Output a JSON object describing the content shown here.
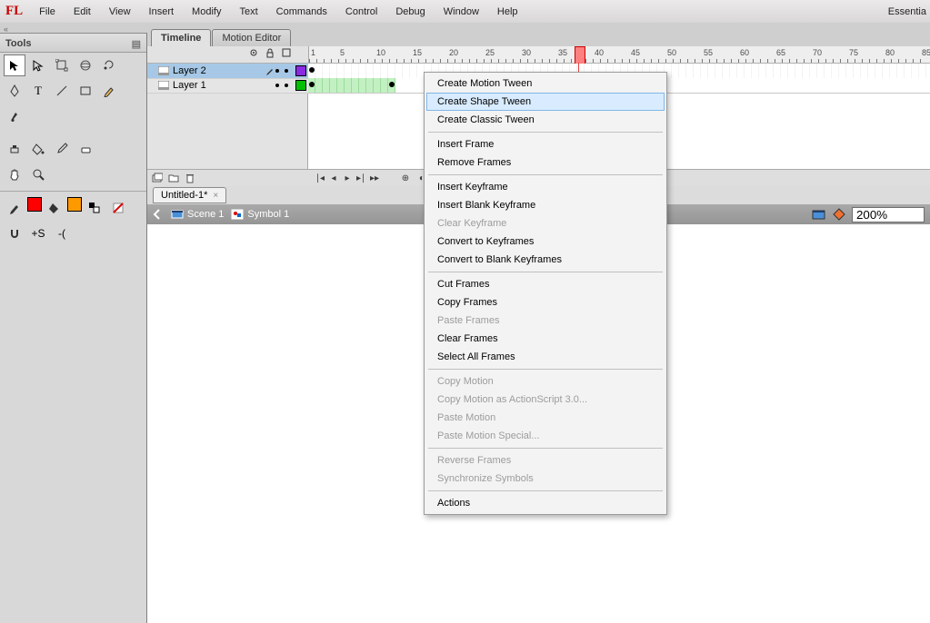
{
  "app_logo": "FL",
  "workspace_label": "Essentia",
  "menus": [
    "File",
    "Edit",
    "View",
    "Insert",
    "Modify",
    "Text",
    "Commands",
    "Control",
    "Debug",
    "Window",
    "Help"
  ],
  "tools_panel": {
    "title": "Tools"
  },
  "timeline_tabs": {
    "timeline": "Timeline",
    "motion_editor": "Motion Editor"
  },
  "ruler": {
    "start": 1,
    "step": 5,
    "end": 85
  },
  "layers": [
    {
      "name": "Layer 2",
      "color": "#8a2be2",
      "selected": true
    },
    {
      "name": "Layer 1",
      "color": "#00c000",
      "selected": false
    }
  ],
  "document": {
    "tab_label": "Untitled-1*"
  },
  "edit_bar": {
    "scene": "Scene 1",
    "symbol": "Symbol 1",
    "zoom": "200%"
  },
  "context_menu": [
    {
      "kind": "item",
      "label": "Create Motion Tween"
    },
    {
      "kind": "item",
      "label": "Create Shape Tween",
      "highlight": true
    },
    {
      "kind": "item",
      "label": "Create Classic Tween"
    },
    {
      "kind": "sep"
    },
    {
      "kind": "item",
      "label": "Insert Frame"
    },
    {
      "kind": "item",
      "label": "Remove Frames"
    },
    {
      "kind": "sep"
    },
    {
      "kind": "item",
      "label": "Insert Keyframe"
    },
    {
      "kind": "item",
      "label": "Insert Blank Keyframe"
    },
    {
      "kind": "item",
      "label": "Clear Keyframe",
      "disabled": true
    },
    {
      "kind": "item",
      "label": "Convert to Keyframes"
    },
    {
      "kind": "item",
      "label": "Convert to Blank Keyframes"
    },
    {
      "kind": "sep"
    },
    {
      "kind": "item",
      "label": "Cut Frames"
    },
    {
      "kind": "item",
      "label": "Copy Frames"
    },
    {
      "kind": "item",
      "label": "Paste Frames",
      "disabled": true
    },
    {
      "kind": "item",
      "label": "Clear Frames"
    },
    {
      "kind": "item",
      "label": "Select All Frames"
    },
    {
      "kind": "sep"
    },
    {
      "kind": "item",
      "label": "Copy Motion",
      "disabled": true
    },
    {
      "kind": "item",
      "label": "Copy Motion as ActionScript 3.0...",
      "disabled": true
    },
    {
      "kind": "item",
      "label": "Paste Motion",
      "disabled": true
    },
    {
      "kind": "item",
      "label": "Paste Motion Special...",
      "disabled": true
    },
    {
      "kind": "sep"
    },
    {
      "kind": "item",
      "label": "Reverse Frames",
      "disabled": true
    },
    {
      "kind": "item",
      "label": "Synchronize Symbols",
      "disabled": true
    },
    {
      "kind": "sep"
    },
    {
      "kind": "item",
      "label": "Actions"
    }
  ]
}
